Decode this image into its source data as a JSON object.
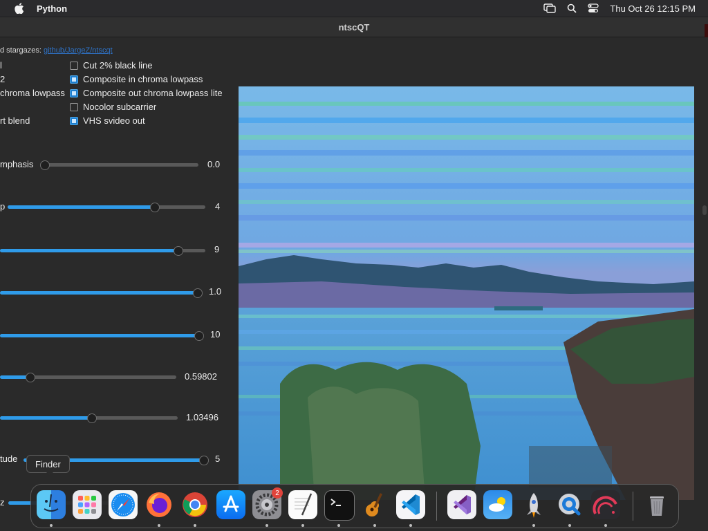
{
  "menubar": {
    "app": "Python",
    "clock": "Thu Oct 26  12:15 PM"
  },
  "window": {
    "title": "ntscQT"
  },
  "info": {
    "prefix": "d stargazes: ",
    "link": "github/JargeZ/ntscqt"
  },
  "left_labels": [
    "l",
    "2",
    "chroma lowpass",
    "rt blend"
  ],
  "checkboxes": [
    {
      "label": "Cut 2% black line",
      "checked": false
    },
    {
      "label": "Composite in chroma lowpass",
      "checked": true
    },
    {
      "label": "Composite out chroma lowpass lite",
      "checked": true
    },
    {
      "label": "Nocolor subcarrier",
      "checked": false
    },
    {
      "label": "VHS svideo out",
      "checked": true
    }
  ],
  "sliders": [
    {
      "label": "mphasis",
      "value": "0.0",
      "level": 0.0
    },
    {
      "label": "p",
      "value": "4",
      "level": 0.75
    },
    {
      "label": "",
      "value": "9",
      "level": 0.88
    },
    {
      "label": "",
      "value": "1.0",
      "level": 1.0
    },
    {
      "label": "",
      "value": "10",
      "level": 1.0
    },
    {
      "label": "",
      "value": "0.59802",
      "level": 0.16
    },
    {
      "label": "",
      "value": "1.03496",
      "level": 0.52
    },
    {
      "label": "tude",
      "value": "5",
      "level": 1.0
    },
    {
      "label": "z",
      "value": "",
      "level": 0.3
    }
  ],
  "tooltip": "Finder",
  "dock": {
    "items": [
      "Finder",
      "Launchpad",
      "Safari",
      "Firefox",
      "Chrome",
      "App Store",
      "System Settings",
      "TextEdit",
      "Terminal",
      "GarageBand",
      "Visual Studio Code",
      "Visual Studio",
      "Weather",
      "Rocket",
      "QuickTime",
      "Podcasts",
      "Trash"
    ],
    "settings_badge": "2"
  }
}
